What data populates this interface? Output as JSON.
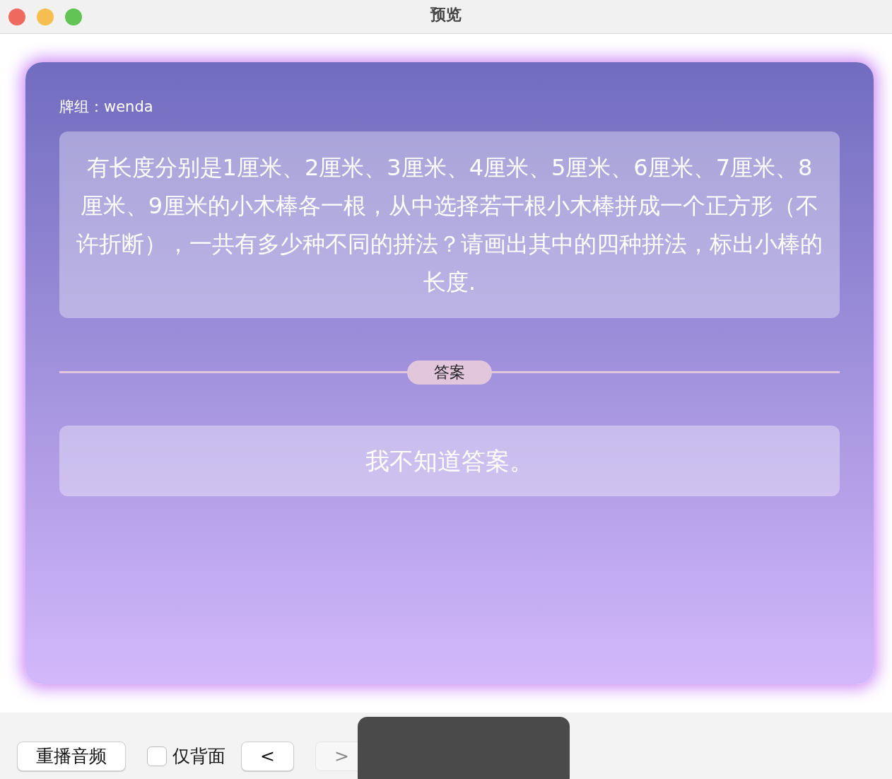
{
  "window": {
    "title": "预览"
  },
  "card": {
    "deck_label": "牌组：wenda",
    "question": "有长度分别是1厘米、2厘米、3厘米、4厘米、5厘米、6厘米、7厘米、8厘米、9厘米的小木棒各一根，从中选择若干根小木棒拼成一个正方形（不许折断），一共有多少种不同的拼法？请画出其中的四种拼法，标出小棒的长度.",
    "divider_label": "答案",
    "answer": "我不知道答案。"
  },
  "toolbar": [
    {
      "kind": "button",
      "label": "重播音频",
      "disabled": false
    },
    {
      "kind": "checkbox",
      "label": "仅背面",
      "checked": false
    },
    {
      "kind": "button",
      "label": "<",
      "disabled": false
    },
    {
      "kind": "button",
      "label": ">",
      "disabled": true
    }
  ]
}
